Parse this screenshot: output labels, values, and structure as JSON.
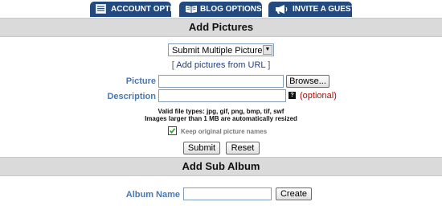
{
  "tabs": {
    "account": {
      "label": "ACCOUNT OPTIONS",
      "icon": "account-list-icon"
    },
    "blog": {
      "label": "BLOG OPTIONS",
      "icon": "book-icon"
    },
    "invite": {
      "label": "INVITE A GUEST",
      "icon": "megaphone-icon"
    }
  },
  "add_pictures": {
    "title": "Add Pictures",
    "upload_mode": {
      "selected": "Submit Multiple Pictures"
    },
    "url_link": {
      "open": "[",
      "label": "Add pictures from URL",
      "close": "]"
    },
    "picture_label": "Picture",
    "browse_label": "Browse...",
    "description_label": "Description",
    "optional_label": "(optional)",
    "help_icon_text": "?",
    "file_types_note": "Valid file types: jpg, gif, png, bmp, tif, swf",
    "resize_note": "Images larger than 1 MB are automatically resized",
    "keep_names_label": "Keep original picture names",
    "keep_names_checked": true,
    "submit_label": "Submit",
    "reset_label": "Reset"
  },
  "add_sub_album": {
    "title": "Add Sub Album",
    "album_name_label": "Album Name",
    "create_label": "Create"
  },
  "colors": {
    "tab_bg": "#234a7e",
    "section_bar": "#dadada",
    "label_blue": "#4a78b0",
    "optional_red": "#c00000"
  }
}
